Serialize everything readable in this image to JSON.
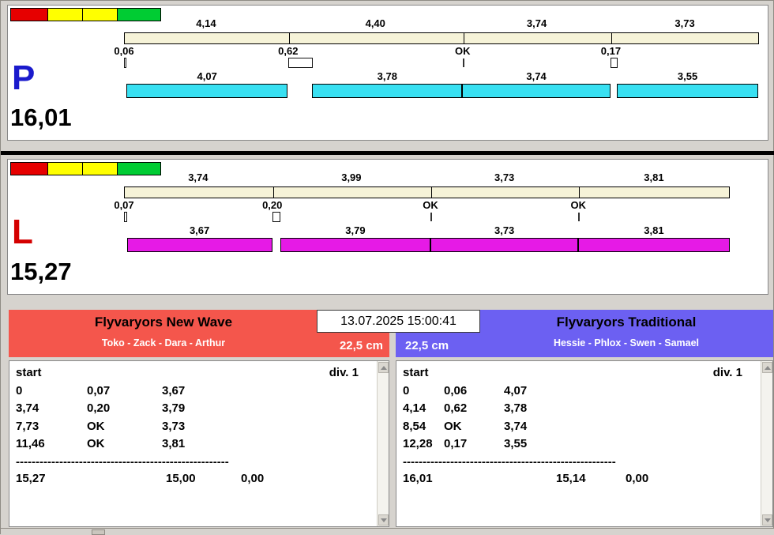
{
  "window": {
    "datetime": "13.07.2025 15:00:41"
  },
  "lanes": [
    {
      "letter": "P",
      "letter_color": "#1a1acc",
      "bar_color": "#38e0f2",
      "total": "16,01",
      "status_blocks": [
        "#e60000",
        "#ffff00",
        "#ffff00",
        "#00cc33"
      ],
      "ideal_segments": [
        {
          "label": "4,14",
          "value": 4.14
        },
        {
          "label": "4,40",
          "value": 4.4
        },
        {
          "label": "3,74",
          "value": 3.74
        },
        {
          "label": "3,73",
          "value": 3.73
        }
      ],
      "faults": [
        {
          "label": "0,06",
          "value": 0.06
        },
        {
          "label": "0,62",
          "value": 0.62
        },
        {
          "label": "OK",
          "value": 0
        },
        {
          "label": "0,17",
          "value": 0.17
        }
      ],
      "actual_segments": [
        {
          "label": "4,07",
          "value": 4.07
        },
        {
          "label": "3,78",
          "value": 3.78
        },
        {
          "label": "3,74",
          "value": 3.74
        },
        {
          "label": "3,55",
          "value": 3.55
        }
      ]
    },
    {
      "letter": "L",
      "letter_color": "#d40000",
      "bar_color": "#e61ae6",
      "total": "15,27",
      "status_blocks": [
        "#e60000",
        "#ffff00",
        "#ffff00",
        "#00cc33"
      ],
      "ideal_segments": [
        {
          "label": "3,74",
          "value": 3.74
        },
        {
          "label": "3,99",
          "value": 3.99
        },
        {
          "label": "3,73",
          "value": 3.73
        },
        {
          "label": "3,81",
          "value": 3.81
        }
      ],
      "faults": [
        {
          "label": "0,07",
          "value": 0.07
        },
        {
          "label": "0,20",
          "value": 0.2
        },
        {
          "label": "OK",
          "value": 0
        },
        {
          "label": "OK",
          "value": 0
        }
      ],
      "actual_segments": [
        {
          "label": "3,67",
          "value": 3.67
        },
        {
          "label": "3,79",
          "value": 3.79
        },
        {
          "label": "3,73",
          "value": 3.73
        },
        {
          "label": "3,81",
          "value": 3.81
        }
      ]
    }
  ],
  "teams": [
    {
      "name": "Flyvaryors New Wave",
      "members": "Toko - Zack - Dara - Arthur",
      "jump_height": "22,5 cm",
      "header_color": "#f4564c",
      "table": {
        "header_left": "start",
        "header_right": "div. 1",
        "rows": [
          [
            "0",
            "0,07",
            "3,67"
          ],
          [
            "3,74",
            "0,20",
            "3,79"
          ],
          [
            "7,73",
            "OK",
            "3,73"
          ],
          [
            "11,46",
            "OK",
            "3,81"
          ]
        ],
        "separator": "------------------------------------------------------",
        "totals": [
          "15,27",
          "15,00",
          "0,00"
        ]
      }
    },
    {
      "name": "Flyvaryors Traditional",
      "members": "Hessie - Phlox - Swen - Samael",
      "jump_height": "22,5 cm",
      "header_color": "#6c60f2",
      "table": {
        "header_left": "start",
        "header_right": "div. 1",
        "rows": [
          [
            "0",
            "0,06",
            "4,07"
          ],
          [
            "4,14",
            "0,62",
            "3,78"
          ],
          [
            "8,54",
            "OK",
            "3,74"
          ],
          [
            "12,28",
            "0,17",
            "3,55"
          ]
        ],
        "separator": "------------------------------------------------------",
        "totals": [
          "16,01",
          "15,14",
          "0,00"
        ]
      }
    }
  ]
}
